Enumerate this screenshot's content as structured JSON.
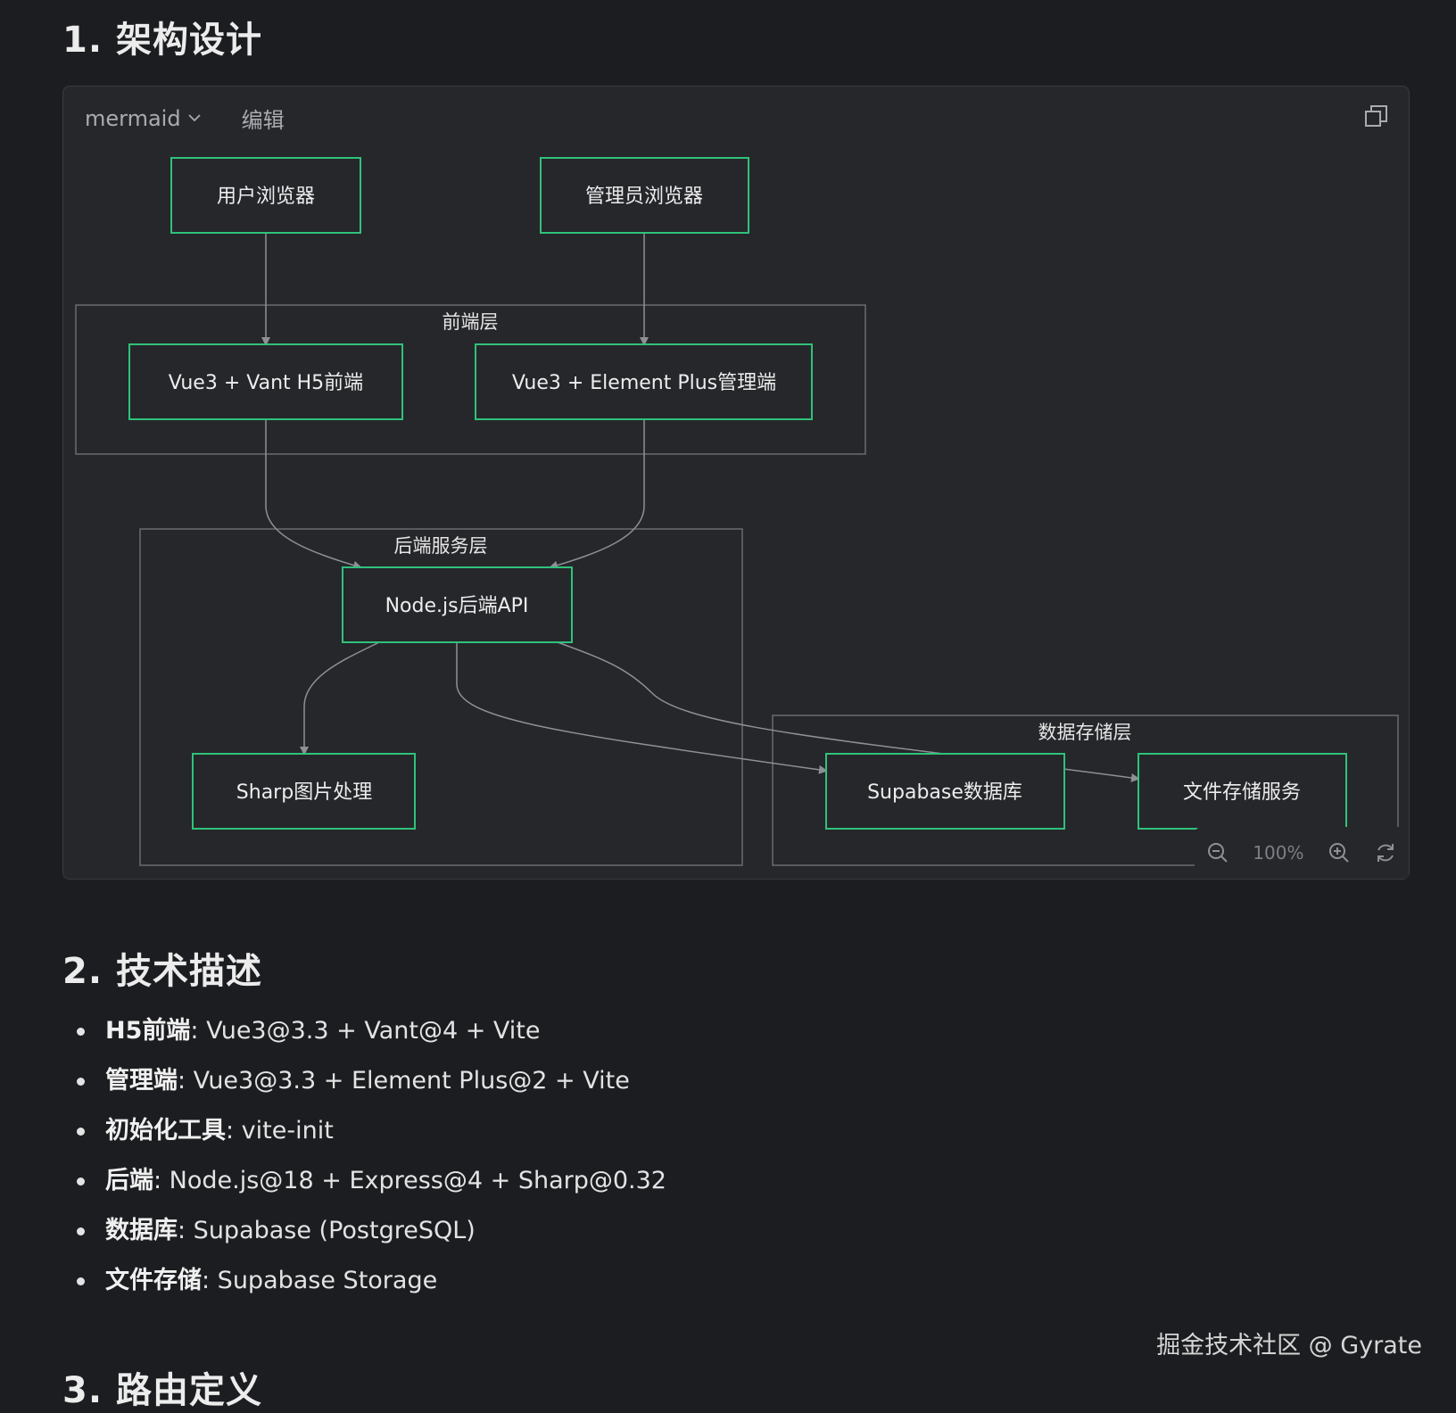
{
  "sections": {
    "architecture_title": "1. 架构设计",
    "tech_title": "2. 技术描述",
    "route_title": "3. 路由定义"
  },
  "code_block": {
    "language": "mermaid",
    "edit_label": "编辑",
    "copy_icon": "copy-icon",
    "zoom": {
      "level": "100%",
      "zoom_out_icon": "zoom-out-icon",
      "zoom_in_icon": "zoom-in-icon",
      "reset_icon": "refresh-icon"
    }
  },
  "diagram": {
    "colors": {
      "node_border": "#2fc27a",
      "subgraph_border": "#6a6b70",
      "edge": "#8e9096",
      "node_fill": "#26272b"
    },
    "subgraphs": {
      "frontend": "前端层",
      "backend": "后端服务层",
      "storage": "数据存储层"
    },
    "nodes": {
      "user_browser": "用户浏览器",
      "admin_browser": "管理员浏览器",
      "h5_frontend": "Vue3 + Vant H5前端",
      "admin_frontend": "Vue3 + Element Plus管理端",
      "node_api": "Node.js后端API",
      "sharp": "Sharp图片处理",
      "supabase_db": "Supabase数据库",
      "file_storage": "文件存储服务"
    }
  },
  "tech_list": [
    {
      "key": "H5前端",
      "value": ": Vue3@3.3 + Vant@4 + Vite"
    },
    {
      "key": "管理端",
      "value": ": Vue3@3.3 + Element Plus@2 + Vite"
    },
    {
      "key": "初始化工具",
      "value": ": vite-init"
    },
    {
      "key": "后端",
      "value": ": Node.js@18 + Express@4 + Sharp@0.32"
    },
    {
      "key": "数据库",
      "value": ": Supabase (PostgreSQL)"
    },
    {
      "key": "文件存储",
      "value": ": Supabase Storage"
    }
  ],
  "watermark": "掘金技术社区 @ Gyrate"
}
